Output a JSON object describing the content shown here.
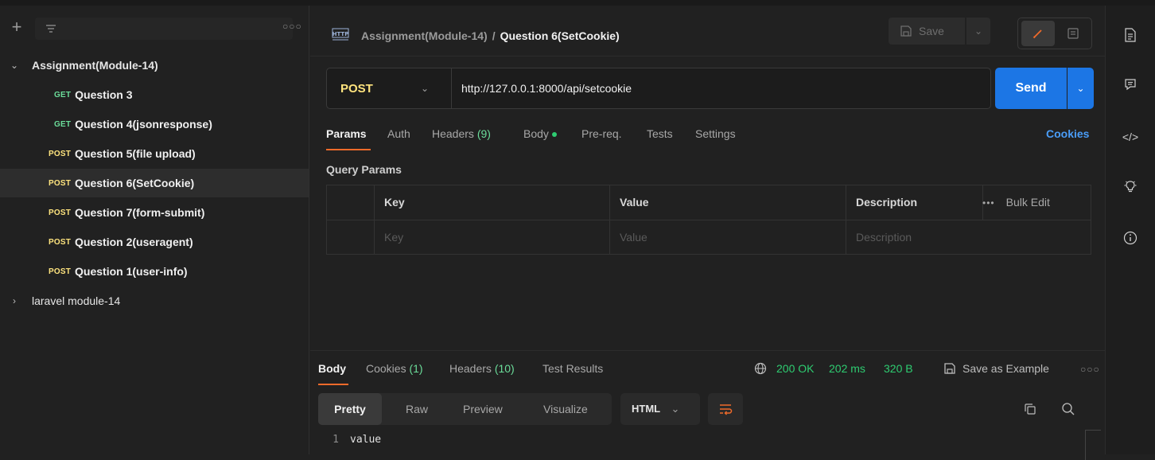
{
  "sidebar": {
    "filter_placeholder": "",
    "items": [
      {
        "kind": "collection",
        "expanded": true,
        "name": "Assignment(Module-14)"
      },
      {
        "kind": "request",
        "method": "GET",
        "name": "Question 3"
      },
      {
        "kind": "request",
        "method": "GET",
        "name": "Question 4(jsonresponse)"
      },
      {
        "kind": "request",
        "method": "POST",
        "name": "Question 5(file upload)"
      },
      {
        "kind": "request",
        "method": "POST",
        "name": "Question 6(SetCookie)",
        "selected": true
      },
      {
        "kind": "request",
        "method": "POST",
        "name": "Question 7(form-submit)"
      },
      {
        "kind": "request",
        "method": "POST",
        "name": "Question 2(useragent)"
      },
      {
        "kind": "request",
        "method": "POST",
        "name": "Question 1(user-info)"
      },
      {
        "kind": "collection",
        "expanded": false,
        "name": "laravel module-14"
      }
    ]
  },
  "header": {
    "collection": "Assignment(Module-14)",
    "separator": "/",
    "request": "Question 6(SetCookie)",
    "save_label": "Save"
  },
  "request": {
    "method": "POST",
    "url": "http://127.0.0.1:8000/api/setcookie",
    "send_label": "Send"
  },
  "req_tabs": {
    "params": "Params",
    "auth": "Auth",
    "headers": "Headers",
    "headers_count": "(9)",
    "body": "Body",
    "prereq": "Pre-req.",
    "tests": "Tests",
    "settings": "Settings",
    "cookies": "Cookies"
  },
  "query_params": {
    "title": "Query Params",
    "columns": {
      "key": "Key",
      "value": "Value",
      "description": "Description"
    },
    "bulk_edit": "Bulk Edit",
    "placeholders": {
      "key": "Key",
      "value": "Value",
      "description": "Description"
    }
  },
  "response": {
    "tabs": {
      "body": "Body",
      "cookies": "Cookies",
      "cookies_count": "(1)",
      "headers": "Headers",
      "headers_count": "(10)",
      "test_results": "Test Results"
    },
    "status": "200 OK",
    "time": "202 ms",
    "size": "320 B",
    "save_example": "Save as Example",
    "views": [
      "Pretty",
      "Raw",
      "Preview",
      "Visualize"
    ],
    "active_view": "Pretty",
    "format": "HTML",
    "lines": [
      {
        "n": "1",
        "text": "value"
      }
    ]
  },
  "colors": {
    "accent": "#1c76e5",
    "post": "#ffe47e",
    "get": "#6bdd9a",
    "status_ok": "#2ecc71",
    "tab_underline": "#f06a2a"
  }
}
